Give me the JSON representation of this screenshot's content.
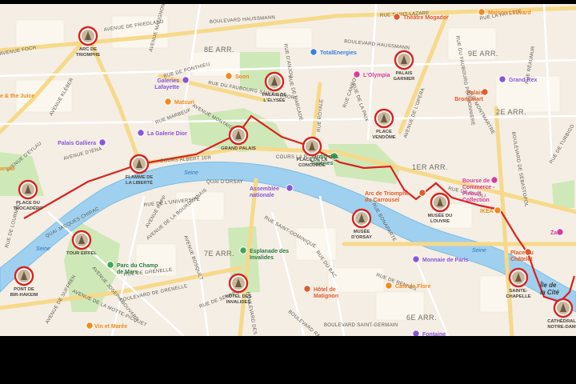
{
  "colors": {
    "land": "#f4eee4",
    "block": "#fbf7ef",
    "park": "#cfe8b8",
    "water": "#9fd0ef",
    "water_edge": "#7fbde6",
    "road_major": "#f6d98a",
    "road_minor": "#ffffff",
    "route": "#d8231f",
    "pin_fill": "#ffffff",
    "poi_orange": "#f08a1c",
    "poi_pink": "#d63c9c",
    "poi_purple": "#8a55d8",
    "poi_blue": "#3b7fd9",
    "poi_green": "#3fa55a",
    "poi_red": "#e25a2b"
  },
  "streets": [
    "AVENUE DE FRIEDLAND",
    "BOULEVARD HAUSSMANN",
    "RUE SAINT-LAZARE",
    "BOULEVARD HAUSSMANN",
    "AVENUE FOCH",
    "COURS ALBERT 1ER",
    "COURS LA R.",
    "QUAI D'ORSAY",
    "QUAI JACQUES CHIRAC",
    "RUE ROYALE",
    "AVENUE DE L'OPÉRA",
    "RUE DE RIVOLI",
    "RUE DE L'UNIVERSITÉ",
    "RUE DE GRENELLE",
    "AVENUE MONTAIGNE",
    "RUE DU FAUBOURG SAINT-HONORÉ",
    "AVENUE DE SUFFREN",
    "BOULEVARD DES INVALIDES",
    "AVENUE DE LA MOTTE-PICQUET",
    "RUE DE SÈVRES",
    "RUE DE RENNES",
    "RUE DU BAC",
    "RUE BONAPARTE",
    "BOULEVARD SAINT-GERMAIN",
    "RUE LA FAYETTE",
    "RUE DE LA PAIX",
    "RUE DE PONTHIEU",
    "RUE CAMBON",
    "AVENUE JOSEPH BOUVARD",
    "AVENUE RAPP",
    "AVENUE D'IÉNA",
    "AVENUE KLÉBER",
    "BOULEVARD RASPAIL",
    "RUE MONTMARTRE",
    "RUE RÉAUMUR",
    "RUE DE TURBIGO",
    "RUE MARBEUF",
    "AVENUE MATIGNON",
    "RUE D'ANJOU",
    "BOULEVARD DE GRENELLE",
    "AVENUE DE LA BOURDONNAIS",
    "RUE DU FAUBOURG POISSONNIÈRE",
    "BOULEVARD DE SÉBASTOPOL",
    "AVENUE D'EYLAU",
    "RUE DE L'ARCADE",
    "RUE DE LOURMEL",
    "AVENUE BOSQUET",
    "RUE SAINT-DOMINIQUE"
  ],
  "districts": [
    "8E ARR.",
    "9E ARR.",
    "2E ARR.",
    "1ER ARR.",
    "7E ARR.",
    "6E ARR."
  ],
  "river": [
    "Seine",
    "Seine",
    "Seine"
  ],
  "landmarks": {
    "arc_triomphe": "ARC DE\nTRIOMPHE",
    "grand_palais": "GRAND PALAIS",
    "concorde": "PLACE DE LA\nCONCORDE",
    "vendome": "PLACE\nVENDÔME",
    "flamme": "FLAMME DE\nLA LIBERTÉ",
    "trocadero": "PLACE DU\nTROCADÉRO",
    "tour_eiffel": "TOUR EIFFEL",
    "pont_bir": "PONT DE\nBIR-HAKEIM",
    "invalides": "HÔTEL DES\nINVALIDES",
    "orsay": "MUSÉE\nD'ORSAY",
    "louvre": "MUSÉE DU\nLOUVRE",
    "sainte_chapelle": "SAINTE-\nCHAPELLE",
    "notre_dame": "CATHÉDRALE\nNOTRE-DAME",
    "palais_elysee": "PALAIS DE\nL'ÉLYSÉE",
    "palais_garnier": "PALAIS\nGARNIER"
  },
  "pois": {
    "theatre_mogador": "Théâtre Mogador",
    "maison_louvard": "Maison Louvard",
    "totalenergies": "TotalEnergies",
    "galeries_lafayette": "Galeries\nLafayette",
    "soon": "Soon",
    "matsuri": "Matsuri",
    "lolympia": "L'Olympia",
    "grand_rex": "Grand Rex",
    "palais_brongniart": "Palais\nBrongniart",
    "palais_galliera": "Palais Galliera",
    "la_galerie_dior": "La Galerie Dior",
    "assemblee": "Assemblée\nnationale",
    "jardin_tuileries": "Jardin des\nTuileries",
    "arc_carrousel": "Arc de Triomphe\ndu Carrousel",
    "bourse_commerce": "Bourse de\nCommerce -\nPinault\nCollection",
    "ikea": "IKEA",
    "place_chatelet": "Place du\nChâtelet",
    "ile_cite": "Île de\nla Cité",
    "zara": "Zara",
    "monnaie": "Monnaie de Paris",
    "cafe_flore": "Café de Flore",
    "hotel_matignon": "Hôtel de\nMatignon",
    "esplanade": "Esplanade des\nInvalides",
    "champ_mars": "Parc du Champ\nde Mars",
    "vin_maree": "Vin et Marée",
    "juice": "e & the Juice",
    "arette": "arette",
    "fontaine": "Fontaine"
  }
}
